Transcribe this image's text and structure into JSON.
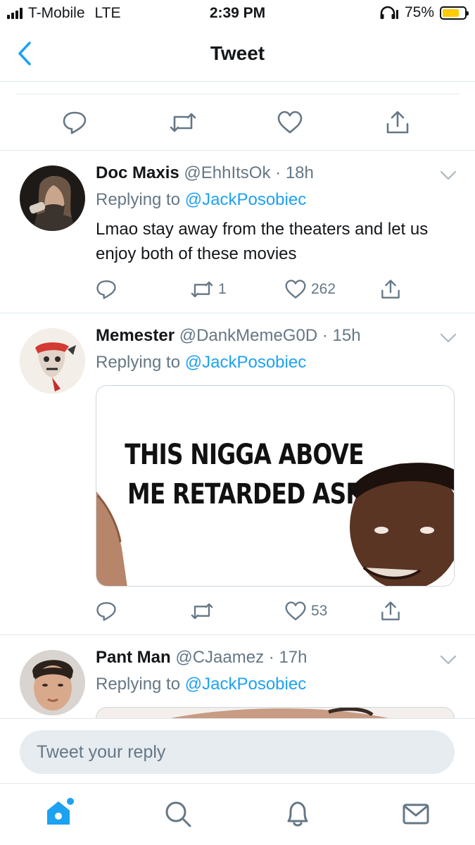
{
  "status_bar": {
    "carrier": "T-Mobile",
    "network": "LTE",
    "time": "2:39 PM",
    "battery": "75%",
    "battery_level": 0.75,
    "battery_color": "#ffcc00"
  },
  "nav": {
    "title": "Tweet",
    "back_icon": "chevron-left-icon"
  },
  "accent_color": "#1da1f2",
  "tweets": [
    {
      "name": "Doc Maxis",
      "handle": "@EhhItsOk",
      "dot": "·",
      "time": "18h",
      "replying_prefix": "Replying to",
      "replying_to": "@JackPosobiec",
      "text": "Lmao stay away from the theaters and let us enjoy both of these movies",
      "retweets": "1",
      "likes": "262"
    },
    {
      "name": "Memester",
      "handle": "@DankMemeG0D",
      "dot": "·",
      "time": "15h",
      "replying_prefix": "Replying to",
      "replying_to": "@JackPosobiec",
      "media_text": "THIS NIGGA ABOVE ME RETARDED ASF",
      "retweets": "",
      "likes": "53"
    },
    {
      "name": "Pant Man",
      "handle": "@CJaamez",
      "dot": "·",
      "time": "17h",
      "replying_prefix": "Replying to",
      "replying_to": "@JackPosobiec"
    }
  ],
  "composer": {
    "placeholder": "Tweet your reply"
  },
  "tabbar": {
    "items": [
      "home-icon",
      "search-icon",
      "bell-icon",
      "mail-icon"
    ]
  }
}
